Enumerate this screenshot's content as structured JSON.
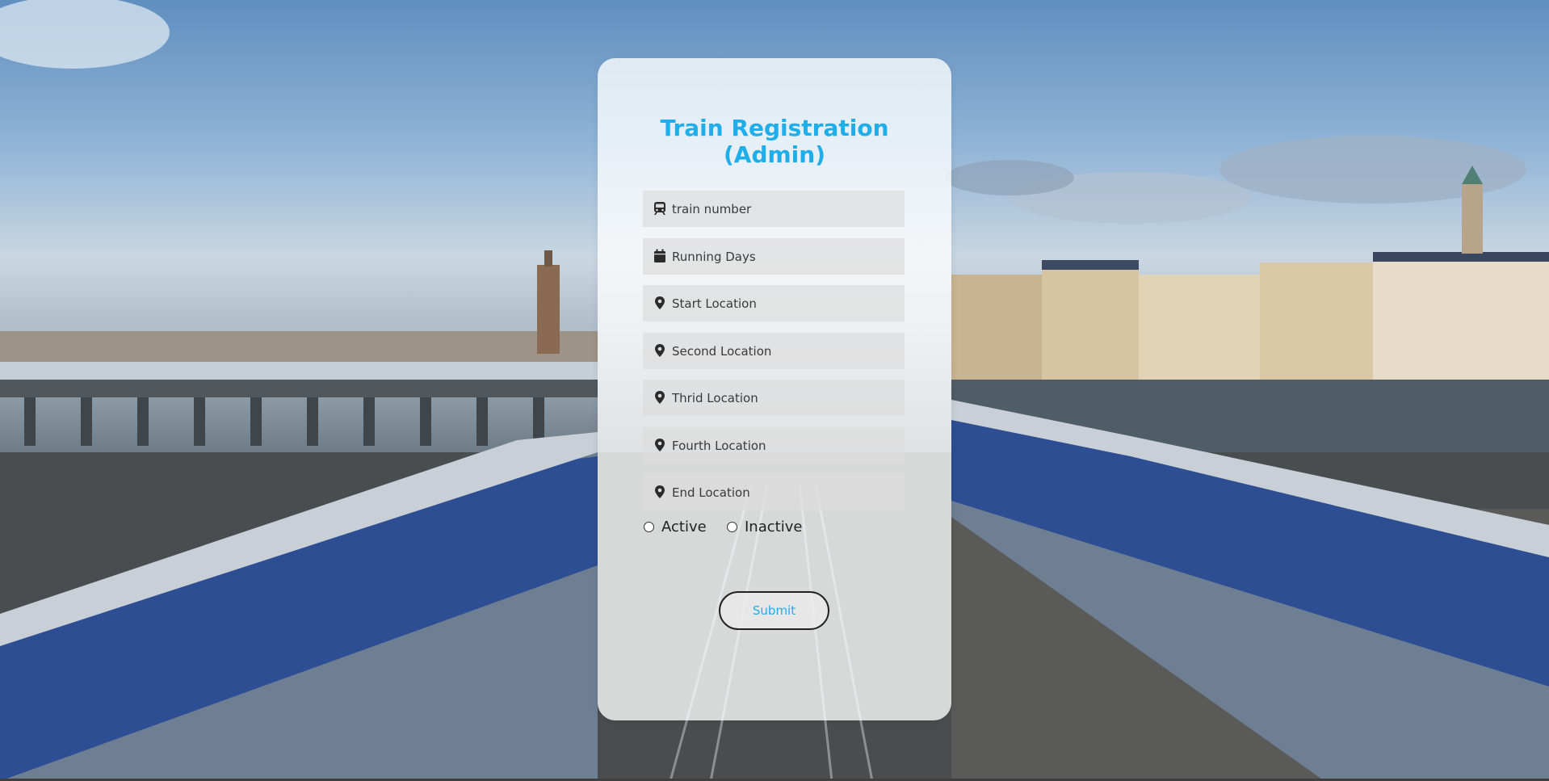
{
  "form": {
    "title_line1": "Train Registration",
    "title_line2": "(Admin)",
    "fields": [
      {
        "placeholder": "train number",
        "icon": "train-icon"
      },
      {
        "placeholder": "Running Days",
        "icon": "calendar-icon"
      },
      {
        "placeholder": "Start Location",
        "icon": "location-pin-icon"
      },
      {
        "placeholder": "Second Location",
        "icon": "location-pin-icon"
      },
      {
        "placeholder": "Thrid Location",
        "icon": "location-pin-icon"
      },
      {
        "placeholder": "Fourth Location",
        "icon": "location-pin-icon"
      },
      {
        "placeholder": "End Location",
        "icon": "location-pin-icon"
      }
    ],
    "status_options": [
      "Active",
      "Inactive"
    ],
    "submit_label": "Submit"
  },
  "colors": {
    "accent": "#1eaee9",
    "card_background": "#ffffff",
    "field_background": "#dcdcdc"
  }
}
